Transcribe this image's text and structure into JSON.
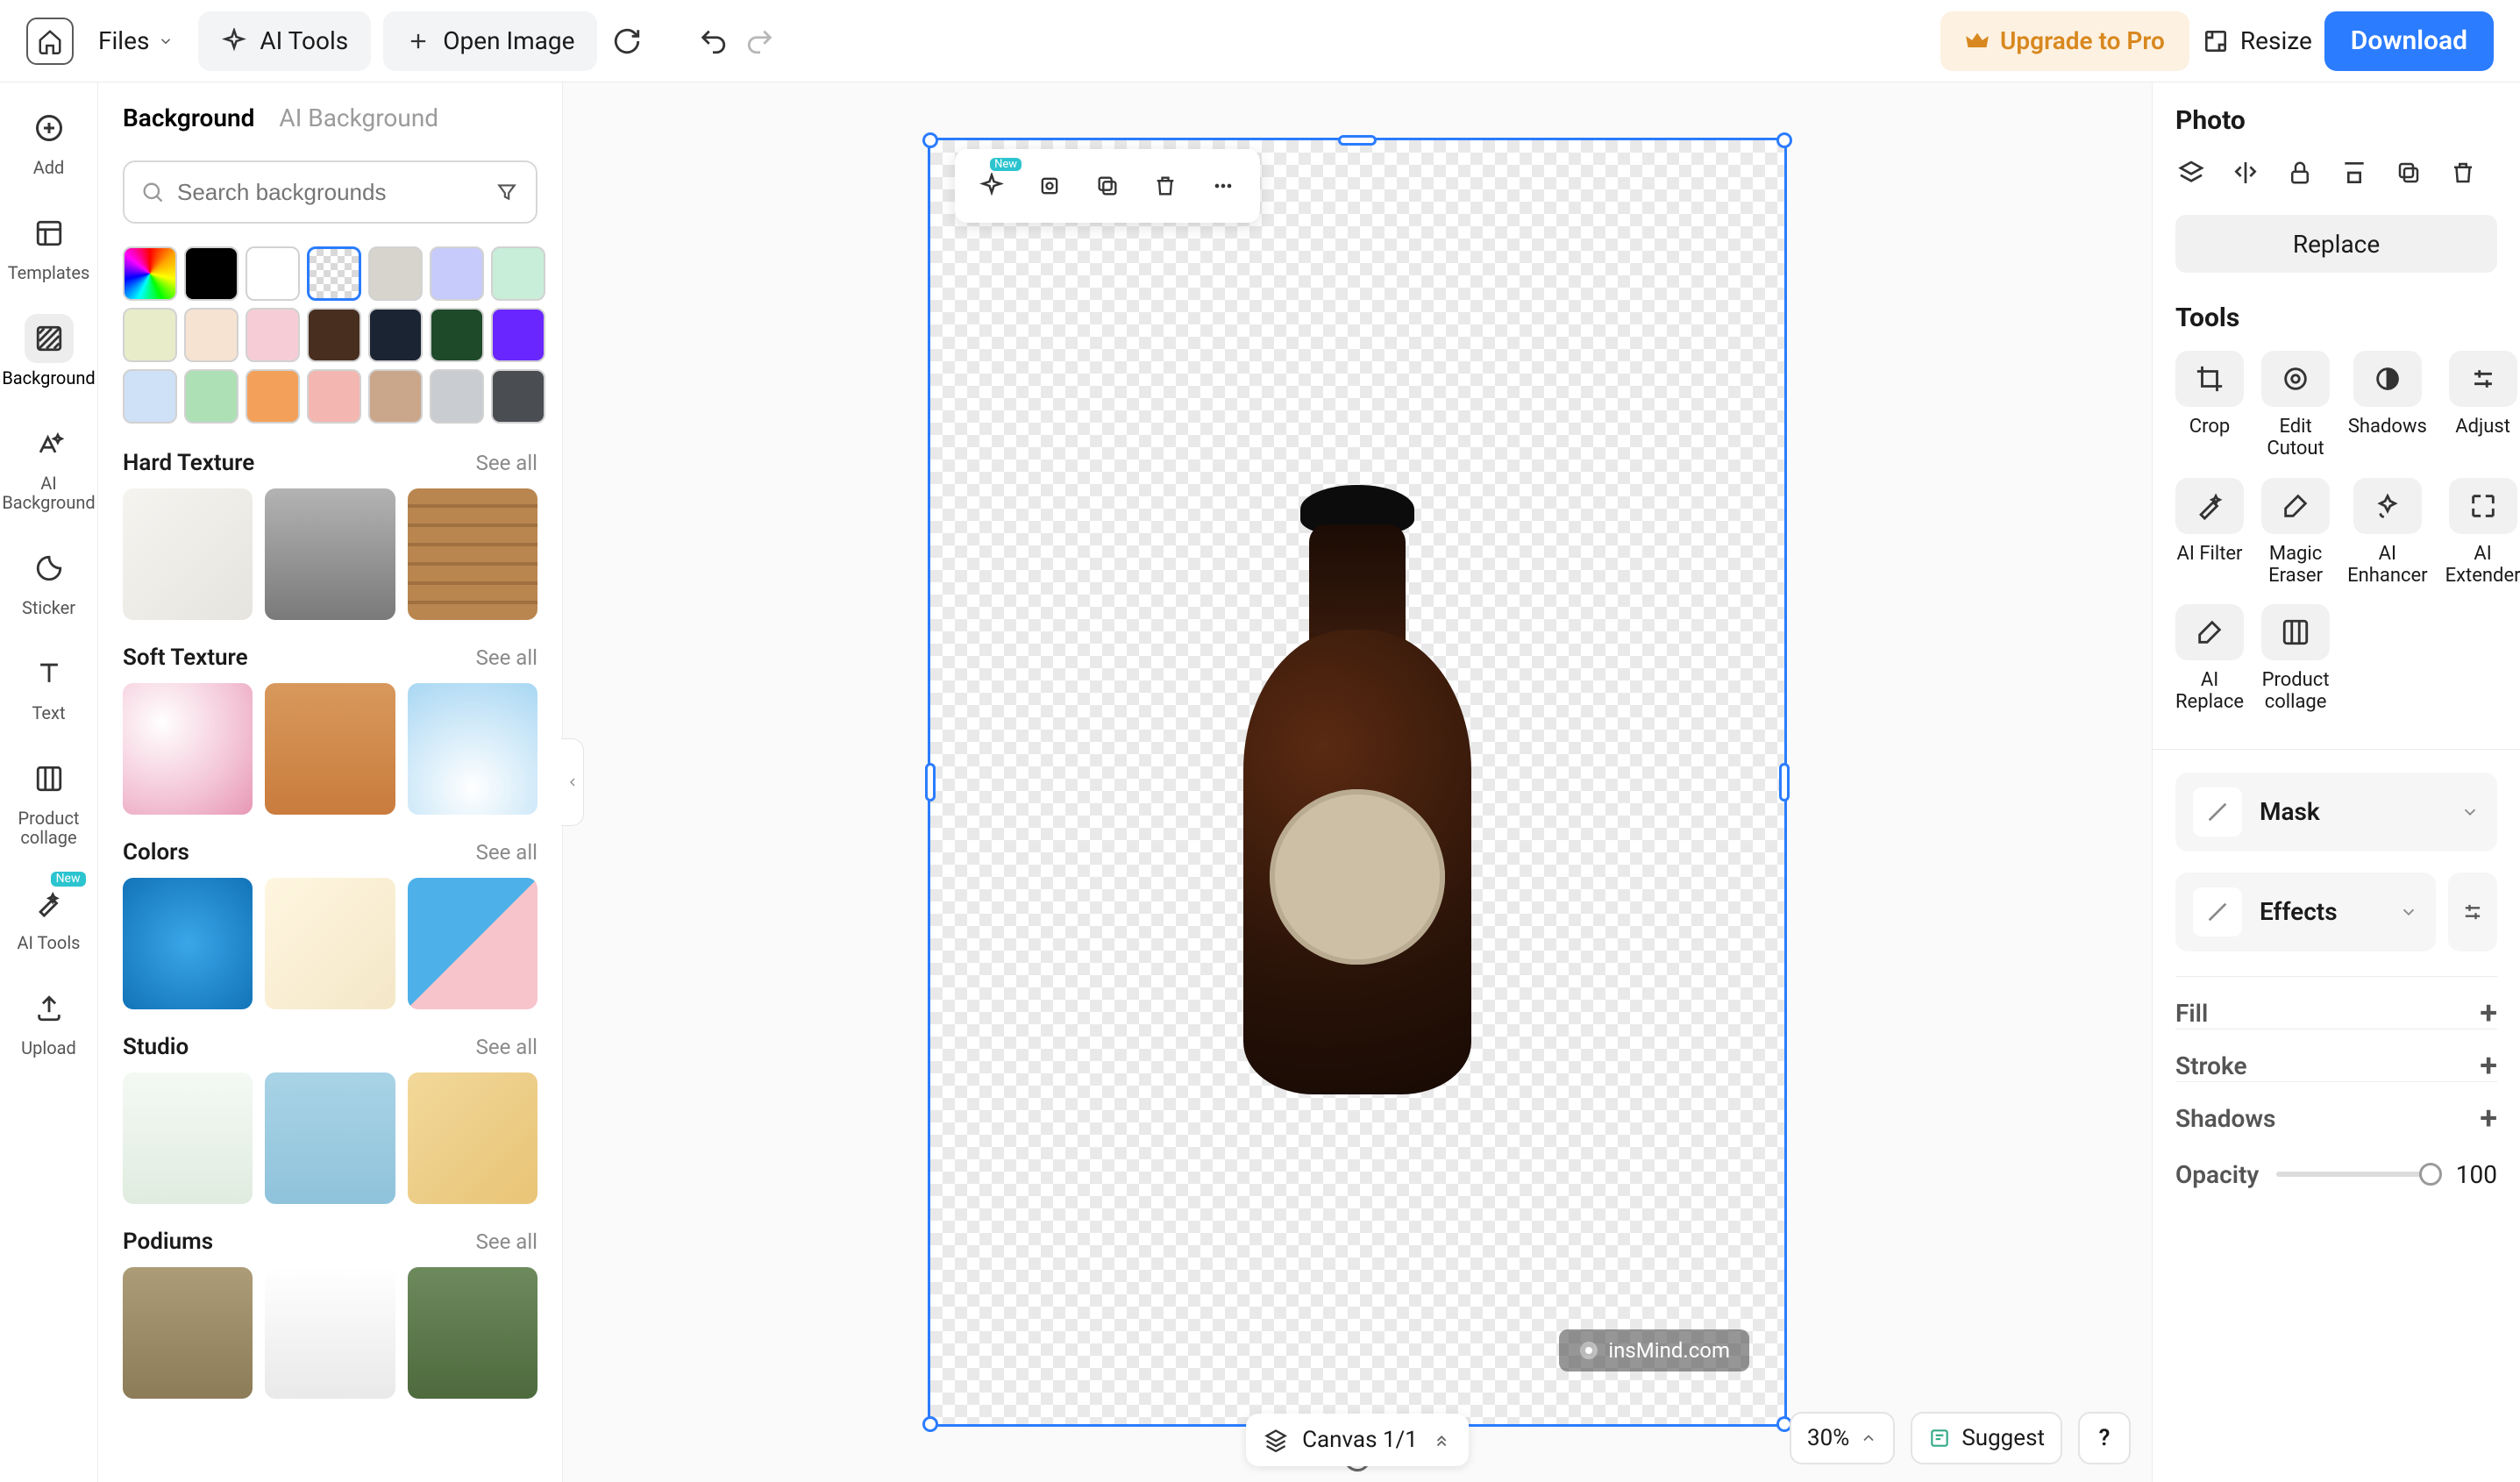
{
  "topbar": {
    "files": "Files",
    "ai_tools": "AI Tools",
    "open_image": "Open Image",
    "upgrade": "Upgrade to Pro",
    "resize": "Resize",
    "download": "Download"
  },
  "rail": {
    "add": "Add",
    "templates": "Templates",
    "background": "Background",
    "ai_background": "AI Background",
    "sticker": "Sticker",
    "text": "Text",
    "product_collage": "Product collage",
    "ai_tools": "AI Tools",
    "upload": "Upload",
    "new_badge": "New"
  },
  "bg_panel": {
    "tab_background": "Background",
    "tab_ai_background": "AI Background",
    "search_placeholder": "Search backgrounds",
    "see_all": "See all",
    "sections": {
      "hard_texture": "Hard Texture",
      "soft_texture": "Soft Texture",
      "colors": "Colors",
      "studio": "Studio",
      "podiums": "Podiums"
    },
    "swatch_colors_row1": [
      "rainbow",
      "#000000",
      "#ffffff",
      "transparent",
      "#d6d4cc",
      "#c7cbfb",
      "#c8edd8"
    ],
    "swatch_colors_row2": [
      "#e9ecc9",
      "#f7e3d2",
      "#f6cdd6",
      "#472e1e",
      "#1b2433",
      "#1e4a2a",
      "#6a26ff"
    ],
    "swatch_colors_row3": [
      "#cfe1f7",
      "#aee0b6",
      "#f3a05a",
      "#f4b6b0",
      "#caa68b",
      "#c9ccd0",
      "#4a4d52"
    ],
    "thumbs": {
      "hard": [
        "#efeeea",
        "#8f8f8f",
        "#b98650"
      ],
      "soft": [
        "#f3c4d6",
        "#c97c3d",
        "#a8d7f3"
      ],
      "colors": [
        "#3aa6e8",
        "#f4e7c8",
        "split"
      ],
      "studio": [
        "#e9f2e8",
        "#8fc3db",
        "#e8c476"
      ],
      "podiums": [
        "#9c8c67",
        "#e9e9e9",
        "#5d7a4d"
      ]
    }
  },
  "canvas": {
    "floating_new": "New",
    "watermark": "insMind.com",
    "pager_label": "Canvas 1/1",
    "zoom": "30%",
    "suggest": "Suggest",
    "help": "?"
  },
  "right": {
    "title": "Photo",
    "replace": "Replace",
    "tools_title": "Tools",
    "tools": {
      "crop": "Crop",
      "edit_cutout": "Edit Cutout",
      "shadows": "Shadows",
      "adjust": "Adjust",
      "ai_filter": "AI Filter",
      "magic_eraser": "Magic Eraser",
      "ai_enhancer": "AI Enhancer",
      "ai_extender": "AI Extender",
      "ai_replace": "AI Replace",
      "product_collage": "Product collage"
    },
    "mask": "Mask",
    "effects": "Effects",
    "fill": "Fill",
    "stroke": "Stroke",
    "shadows_prop": "Shadows",
    "opacity": "Opacity",
    "opacity_value": "100"
  }
}
